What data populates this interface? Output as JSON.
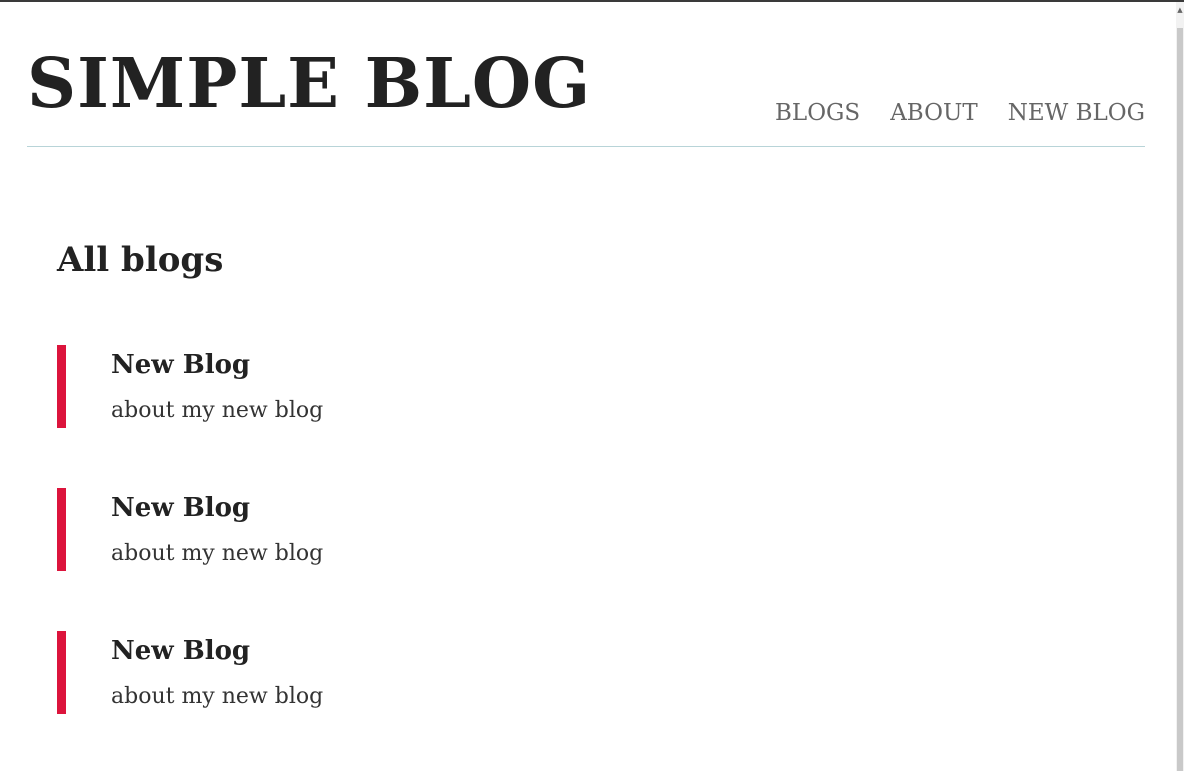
{
  "colors": {
    "accent": "#dc143c",
    "text": "#222222",
    "nav_text": "#666666",
    "header_rule": "#b8d4d8"
  },
  "header": {
    "site_title": "SIMPLE BLOG",
    "nav": [
      {
        "label": "BLOGS"
      },
      {
        "label": "ABOUT"
      },
      {
        "label": "NEW BLOG"
      }
    ]
  },
  "main": {
    "heading": "All blogs",
    "blogs": [
      {
        "title": "New Blog",
        "snippet": "about my new blog"
      },
      {
        "title": "New Blog",
        "snippet": "about my new blog"
      },
      {
        "title": "New Blog",
        "snippet": "about my new blog"
      }
    ]
  }
}
